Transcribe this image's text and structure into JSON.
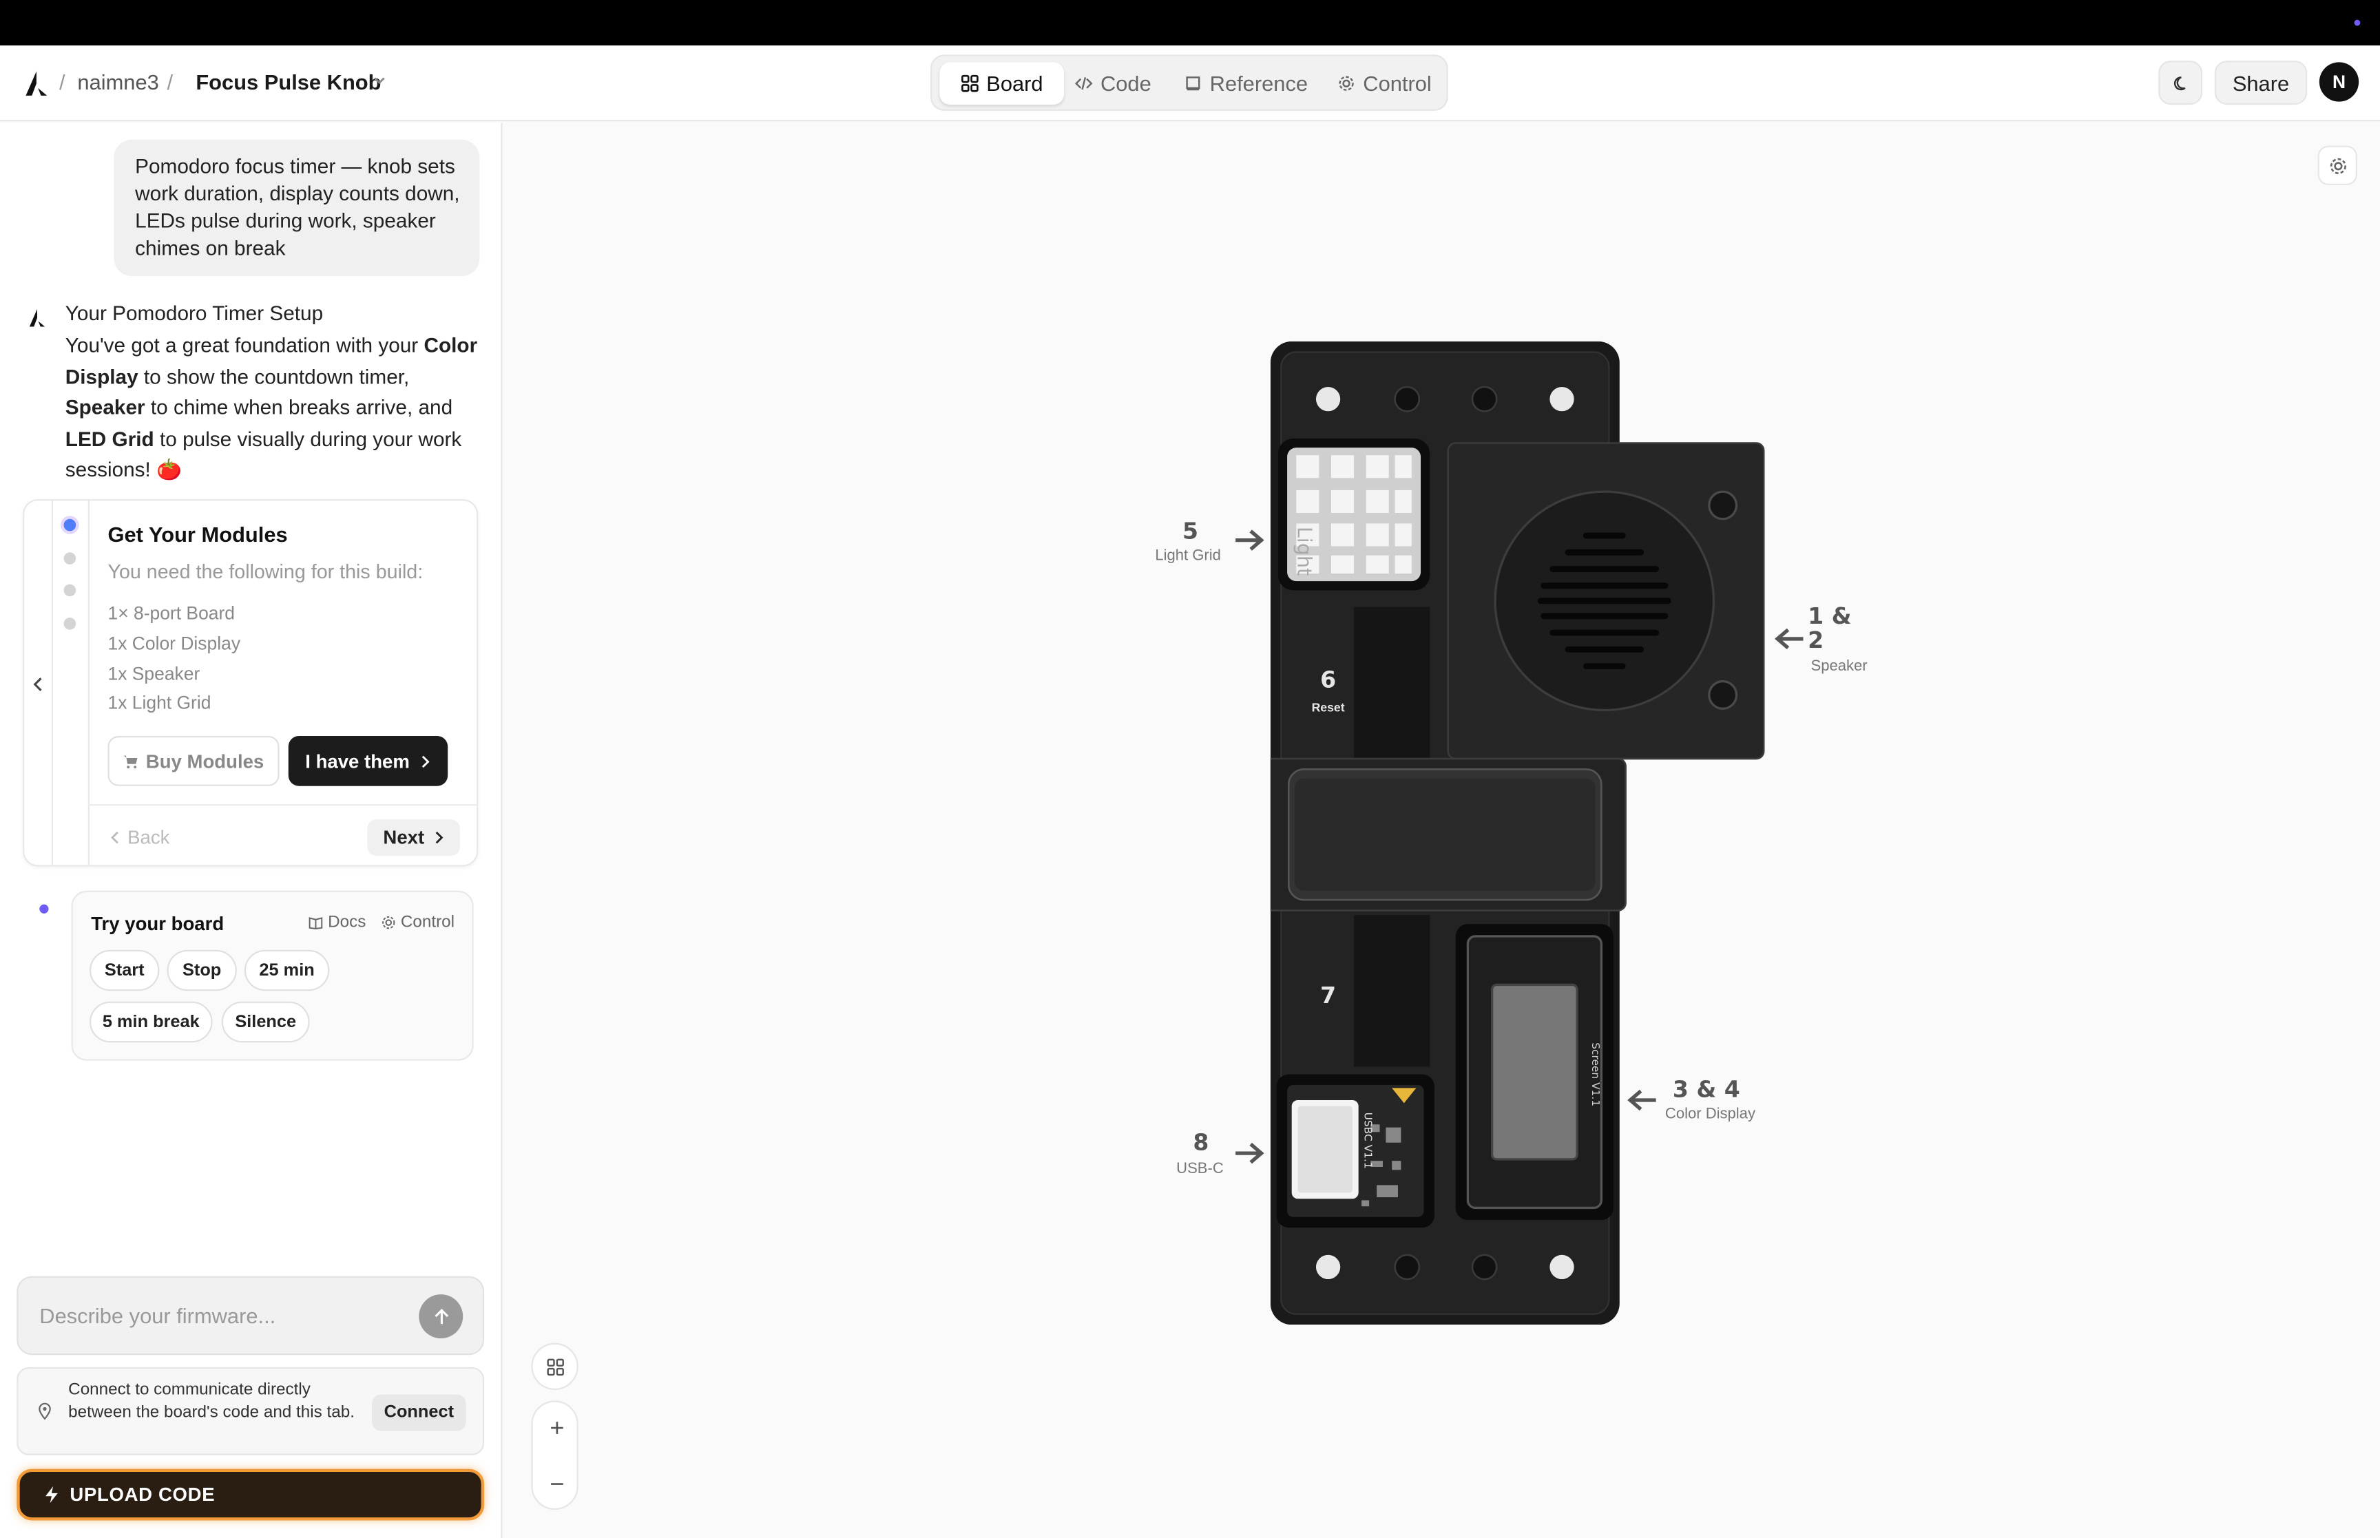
{
  "header": {
    "user": "naimne3",
    "project": "Focus Pulse Knob",
    "separator": "/",
    "tabs": [
      {
        "label": "Board",
        "active": true
      },
      {
        "label": "Code",
        "active": false
      },
      {
        "label": "Reference",
        "active": false
      },
      {
        "label": "Control",
        "active": false
      }
    ],
    "share_label": "Share",
    "avatar_initial": "N"
  },
  "chat": {
    "user_message": "Pomodoro focus timer — knob sets work duration, display counts down, LEDs pulse during work, speaker chimes on break",
    "assistant_title": "Your Pomodoro Timer Setup",
    "assistant_body": {
      "p1": "You've got a great foundation with your ",
      "b1": "Color Display",
      "p2": " to show the countdown timer, ",
      "b2": "Speaker",
      "p3": " to chime when breaks arrive, and ",
      "b3": "LED Grid",
      "p4": " to pulse visually during your work sessions! 🍅"
    }
  },
  "steps": {
    "title": "Get Your Modules",
    "subtitle": "You need the following for this build:",
    "items": [
      "1× 8-port Board",
      "1x Color Display",
      "1x Speaker",
      "1x Light Grid"
    ],
    "buy_label": "Buy Modules",
    "have_label": "I have them",
    "back_label": "Back",
    "next_label": "Next"
  },
  "try": {
    "title": "Try your board",
    "docs_label": "Docs",
    "control_label": "Control",
    "chips": [
      "Start",
      "Stop",
      "25 min",
      "5 min break",
      "Silence"
    ]
  },
  "composer": {
    "placeholder": "Describe your firmware..."
  },
  "connect": {
    "text": "Connect to communicate directly between the board's code and this tab.",
    "button": "Connect"
  },
  "upload": {
    "label": "UPLOAD CODE"
  },
  "board": {
    "labels": {
      "p5_num": "5",
      "p5_name": "Light Grid",
      "p12_num_a": "1 &",
      "p12_num_b": "2",
      "p12_name": "Speaker",
      "p6_num": "6",
      "p6_name": "Reset",
      "p7_num": "7",
      "p8_num": "8",
      "p8_name": "USB-C",
      "p34_num": "3 & 4",
      "p34_name": "Color Display"
    },
    "silk": {
      "light": "Light",
      "usbc": "USBC V1.1",
      "screen": "Screen V1.1"
    }
  },
  "colors": {
    "accent": "#6d5cf6",
    "upload_border": "#f29b38",
    "upload_bg": "#2a1d12",
    "board": "#1e1e1e"
  }
}
